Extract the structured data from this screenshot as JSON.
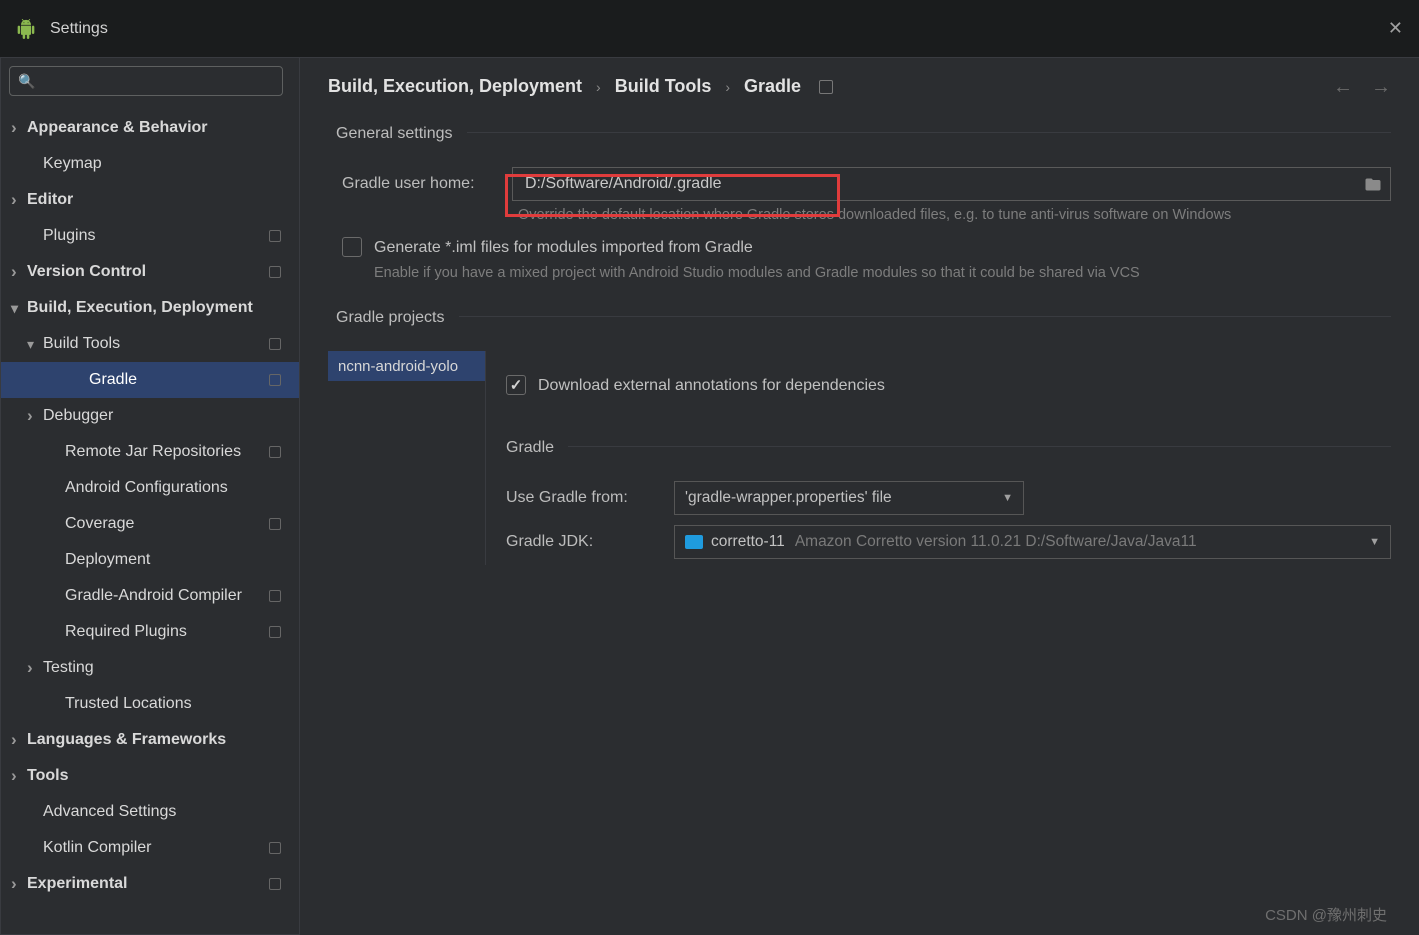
{
  "titlebar": {
    "title": "Settings"
  },
  "search": {
    "placeholder": ""
  },
  "sidebar": [
    {
      "label": "Appearance & Behavior",
      "arrow": "right",
      "lvl": 0,
      "ind": false
    },
    {
      "label": "Keymap",
      "arrow": "none",
      "lvl": 1,
      "ind": false
    },
    {
      "label": "Editor",
      "arrow": "right",
      "lvl": 0,
      "ind": false
    },
    {
      "label": "Plugins",
      "arrow": "none",
      "lvl": 1,
      "ind": true
    },
    {
      "label": "Version Control",
      "arrow": "right",
      "lvl": 0,
      "ind": true
    },
    {
      "label": "Build, Execution, Deployment",
      "arrow": "down",
      "lvl": 0,
      "ind": false
    },
    {
      "label": "Build Tools",
      "arrow": "down",
      "lvl": 1,
      "ind": true
    },
    {
      "label": "Gradle",
      "arrow": "none",
      "lvl": 3,
      "ind": true,
      "selected": true
    },
    {
      "label": "Debugger",
      "arrow": "right",
      "lvl": 1,
      "ind": false
    },
    {
      "label": "Remote Jar Repositories",
      "arrow": "none",
      "lvl": 2,
      "ind": true
    },
    {
      "label": "Android Configurations",
      "arrow": "none",
      "lvl": 2,
      "ind": false
    },
    {
      "label": "Coverage",
      "arrow": "none",
      "lvl": 2,
      "ind": true
    },
    {
      "label": "Deployment",
      "arrow": "none",
      "lvl": 2,
      "ind": false
    },
    {
      "label": "Gradle-Android Compiler",
      "arrow": "none",
      "lvl": 2,
      "ind": true
    },
    {
      "label": "Required Plugins",
      "arrow": "none",
      "lvl": 2,
      "ind": true
    },
    {
      "label": "Testing",
      "arrow": "right",
      "lvl": 1,
      "ind": false
    },
    {
      "label": "Trusted Locations",
      "arrow": "none",
      "lvl": 2,
      "ind": false
    },
    {
      "label": "Languages & Frameworks",
      "arrow": "right",
      "lvl": 0,
      "ind": false
    },
    {
      "label": "Tools",
      "arrow": "right",
      "lvl": 0,
      "ind": false
    },
    {
      "label": "Advanced Settings",
      "arrow": "none",
      "lvl": 1,
      "ind": false
    },
    {
      "label": "Kotlin Compiler",
      "arrow": "none",
      "lvl": 1,
      "ind": true
    },
    {
      "label": "Experimental",
      "arrow": "right",
      "lvl": 0,
      "ind": true
    }
  ],
  "breadcrumb": {
    "items": [
      "Build, Execution, Deployment",
      "Build Tools",
      "Gradle"
    ]
  },
  "sections": {
    "general": "General settings",
    "gradle_projects": "Gradle projects",
    "gradle_sub": "Gradle"
  },
  "form": {
    "gradle_user_home_label": "Gradle user home:",
    "gradle_user_home_value": "D:/Software/Android/.gradle",
    "gradle_user_home_hint": "Override the default location where Gradle stores downloaded files, e.g. to tune anti-virus software on Windows",
    "generate_iml_label": "Generate *.iml files for modules imported from Gradle",
    "generate_iml_hint": "Enable if you have a mixed project with Android Studio modules and Gradle modules so that it could be shared via VCS",
    "download_annotations_label": "Download external annotations for dependencies",
    "use_gradle_from_label": "Use Gradle from:",
    "use_gradle_from_value": "'gradle-wrapper.properties' file",
    "gradle_jdk_label": "Gradle JDK:",
    "gradle_jdk_name": "corretto-11",
    "gradle_jdk_detail": "Amazon Corretto version 11.0.21 D:/Software/Java/Java11"
  },
  "projects": {
    "items": [
      "ncnn-android-yolo"
    ]
  },
  "watermark": "CSDN @豫州刺史"
}
